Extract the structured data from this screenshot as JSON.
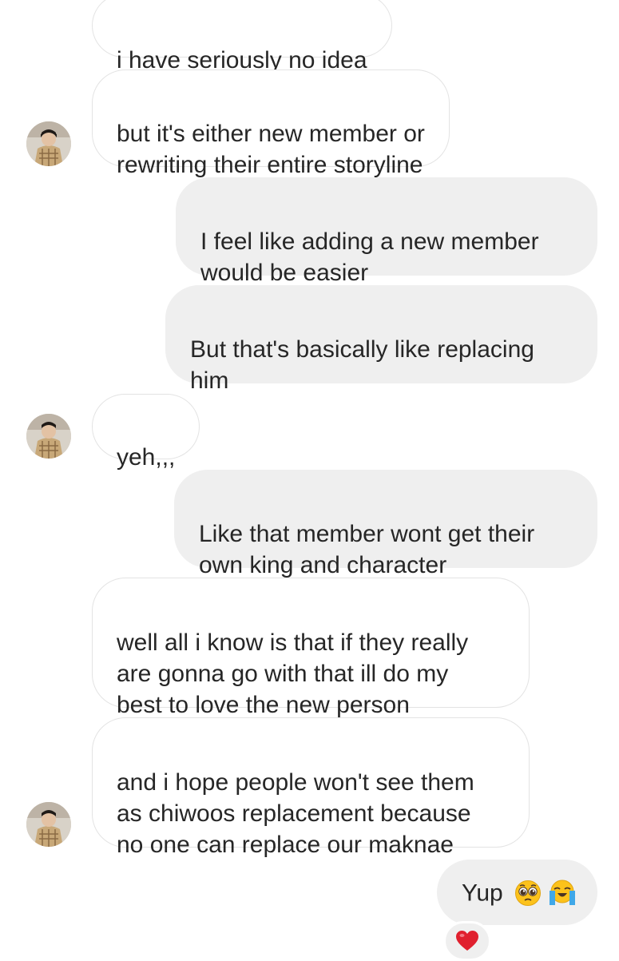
{
  "messages": [
    {
      "id": "m1",
      "side": "in",
      "text": "i have seriously no idea"
    },
    {
      "id": "m2",
      "side": "in",
      "text": "but it's either new member or\nrewriting their entire storyline"
    },
    {
      "id": "m3",
      "side": "out",
      "text": "I feel like adding a new member\nwould be easier"
    },
    {
      "id": "m4",
      "side": "out",
      "text": "But that's basically like replacing\nhim"
    },
    {
      "id": "m5",
      "side": "in",
      "text": "yeh,,,"
    },
    {
      "id": "m6",
      "side": "out",
      "text": "Like that member wont get their\nown king and character"
    },
    {
      "id": "m7",
      "side": "in",
      "text": "well all i know is that if they really\nare gonna go with that ill do my\nbest to love the new person"
    },
    {
      "id": "m8",
      "side": "in",
      "text": "and i hope people won't see them\nas chiwoos replacement because\nno one can replace our maknae"
    },
    {
      "id": "m9",
      "side": "out",
      "text": "Yup",
      "emojis": [
        "pleading-face-icon",
        "loudly-crying-face-icon"
      ]
    }
  ],
  "reaction": {
    "emoji": "red-heart-icon"
  },
  "colors": {
    "outgoing_bubble": "#efefef",
    "incoming_border": "#e3e3e3",
    "text": "#262626",
    "heart": "#e0202e"
  }
}
